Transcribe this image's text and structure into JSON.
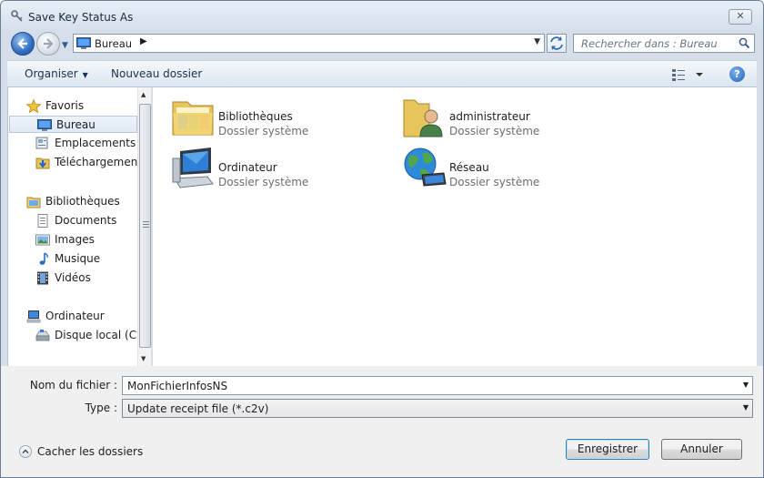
{
  "window": {
    "title": "Save Key Status As",
    "close_label": "✕"
  },
  "address": {
    "location": "Bureau",
    "search_placeholder": "Rechercher dans : Bureau"
  },
  "toolbar": {
    "organize_label": "Organiser",
    "new_folder_label": "Nouveau dossier",
    "help_label": "?"
  },
  "sidebar": {
    "favorites": {
      "label": "Favoris",
      "icon": "star-icon"
    },
    "favorite_items": [
      {
        "label": "Bureau",
        "icon": "desktop-icon",
        "selected": true
      },
      {
        "label": "Emplacements récents",
        "icon": "recent-places-icon"
      },
      {
        "label": "Téléchargements",
        "icon": "downloads-icon"
      }
    ],
    "libraries": {
      "label": "Bibliothèques",
      "icon": "libraries-icon"
    },
    "library_items": [
      {
        "label": "Documents",
        "icon": "documents-icon"
      },
      {
        "label": "Images",
        "icon": "pictures-icon"
      },
      {
        "label": "Musique",
        "icon": "music-icon"
      },
      {
        "label": "Vidéos",
        "icon": "videos-icon"
      }
    ],
    "computer": {
      "label": "Ordinateur",
      "icon": "computer-icon"
    },
    "computer_items": [
      {
        "label": "Disque local (C:)",
        "icon": "local-disk-icon"
      }
    ]
  },
  "content": {
    "items": [
      {
        "name": "Bibliothèques",
        "type": "Dossier système",
        "icon": "libraries-folder-icon"
      },
      {
        "name": "administrateur",
        "type": "Dossier système",
        "icon": "user-folder-icon"
      },
      {
        "name": "Ordinateur",
        "type": "Dossier système",
        "icon": "computer-icon"
      },
      {
        "name": "Réseau",
        "type": "Dossier système",
        "icon": "network-globe-icon"
      }
    ]
  },
  "form": {
    "filename_label": "Nom du fichier :",
    "filename_value": "MonFichierInfosNS",
    "type_label": "Type :",
    "type_value": "Update receipt file (*.c2v)"
  },
  "footer": {
    "hide_folders_label": "Cacher les dossiers",
    "save_label": "Enregistrer",
    "cancel_label": "Annuler"
  },
  "colors": {
    "accent": "#3c7fb1",
    "selection": "#dfe9f6",
    "chrome": "#d5dee9"
  }
}
